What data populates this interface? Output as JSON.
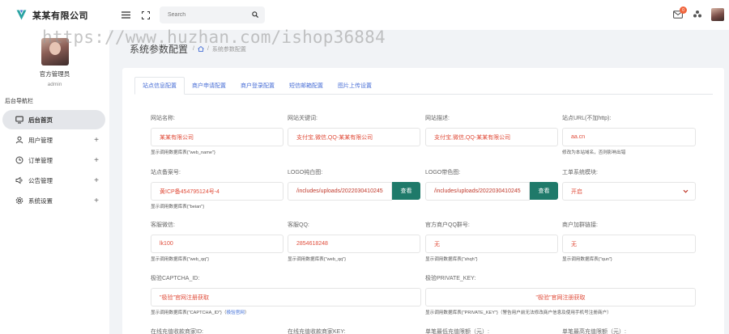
{
  "brand": {
    "name": "某某有限公司"
  },
  "profile": {
    "name": "官方管理员",
    "role": "admin"
  },
  "nav": {
    "title": "后台导航栏",
    "items": [
      {
        "label": "后台首页",
        "icon": "monitor-icon",
        "active": true,
        "expandable": false
      },
      {
        "label": "用户管理",
        "icon": "user-icon",
        "active": false,
        "expandable": true
      },
      {
        "label": "订单管理",
        "icon": "clock-icon",
        "active": false,
        "expandable": true
      },
      {
        "label": "公告管理",
        "icon": "speaker-icon",
        "active": false,
        "expandable": true
      },
      {
        "label": "系统设置",
        "icon": "gear-icon",
        "active": false,
        "expandable": true
      }
    ]
  },
  "header": {
    "search_placeholder": "Search",
    "notification_count": "0"
  },
  "watermark": "https://www.huzhan.com/ishop36884",
  "page": {
    "title": "系统参数配置",
    "breadcrumb_sep": "/",
    "breadcrumb_current": "系统参数配置"
  },
  "tabs": [
    "站点信息配置",
    "商户申请配置",
    "商户登录配置",
    "短信邮箱配置",
    "图片上传设置"
  ],
  "form": {
    "site_name": {
      "label": "网站名称:",
      "value": "某某有限公司",
      "help": "显示调用数据库表{\"web_name\"}"
    },
    "keywords": {
      "label": "网站关键词:",
      "value": "支付宝,微信,QQ-某某有限公司"
    },
    "description": {
      "label": "网站描述:",
      "value": "支付宝,微信,QQ-某某有限公司"
    },
    "site_url": {
      "label": "站点URL(不加http):",
      "value": "aa.cn",
      "help": "修改为本站域名，否则影响出错"
    },
    "icp": {
      "label": "站点备案号:",
      "value": "黄ICP备454795124号-4",
      "help": "显示调用数据库表{\"beian\"}"
    },
    "logo_white": {
      "label": "LOGO纯白图:",
      "value": "/includes/uploads/2022030410245",
      "button": "查看"
    },
    "logo_color": {
      "label": "LOGO带色图:",
      "value": "/includes/uploads/2022030410245",
      "button": "查看"
    },
    "ticket": {
      "label": "工单系统模块:",
      "value": "开启"
    },
    "service_wx": {
      "label": "客服微信:",
      "value": "lk100",
      "help": "显示调用数据库表{\"web_qq\"}"
    },
    "service_qq": {
      "label": "客服QQ:",
      "value": "2854618248",
      "help": "显示调用数据库表{\"web_qq\"}"
    },
    "merchant_qq_group": {
      "label": "官方商户QQ群号:",
      "value": "无",
      "help": "显示调用数据库表{\"shqh\"}"
    },
    "merchant_group_link": {
      "label": "商户加群链接:",
      "value": "无",
      "help": "显示调用数据库表{\"qun\"}"
    },
    "captcha_id": {
      "label": "极验CAPTCHA_ID:",
      "value": "\"极验\"官网注册获取",
      "help": "显示调用数据库表{\"CAPTCHA_ID\"}（",
      "help_link": "极验官网",
      "help_end": "）"
    },
    "private_key": {
      "label": "极验PRIVATE_KEY:",
      "value": "\"极验\"官网注册获取",
      "help": "显示调用数据库表{\"PRIVATE_KEY\"}（警告用户前无法修改商户信息及使用手机号注册商户）"
    },
    "pay_merchant_id": {
      "label": "在线充值收款商家ID:"
    },
    "pay_merchant_key": {
      "label": "在线充值收款商家KEY:"
    },
    "min_recharge": {
      "label": "单笔最低充值限额（元）:"
    },
    "max_recharge": {
      "label": "单笔最高充值限额（元）:"
    }
  },
  "colors": {
    "accent": "#4a6fd6",
    "value_text": "#e04c3a",
    "button": "#1f7a6a",
    "badge": "#f0643c"
  }
}
